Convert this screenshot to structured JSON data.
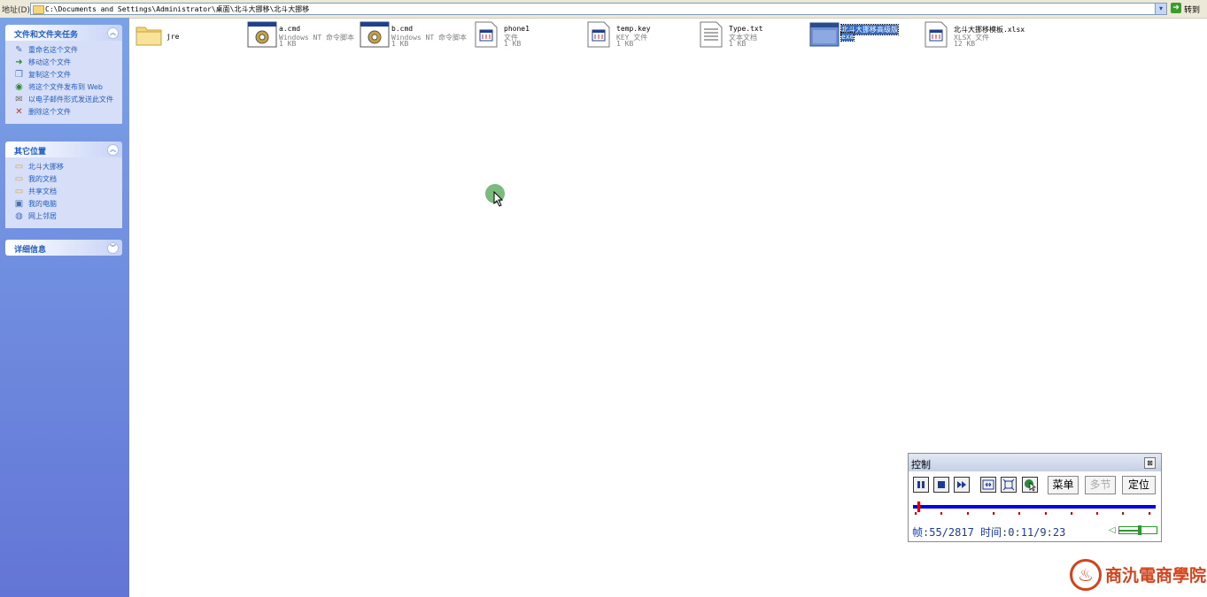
{
  "addressbar": {
    "label": "地址(D)",
    "path": "C:\\Documents and Settings\\Administrator\\桌面\\北斗大挪移\\北斗大挪移",
    "dropdown_glyph": "▾",
    "go_label": "转到"
  },
  "tasks_panel": {
    "title": "文件和文件夹任务",
    "items": [
      {
        "label": "重命名这个文件",
        "icon": "rename-icon"
      },
      {
        "label": "移动这个文件",
        "icon": "move-icon"
      },
      {
        "label": "复制这个文件",
        "icon": "copy-icon"
      },
      {
        "label": "将这个文件发布到 Web",
        "icon": "web-publish-icon"
      },
      {
        "label": "以电子邮件形式发送此文件",
        "icon": "email-icon"
      },
      {
        "label": "删除这个文件",
        "icon": "delete-icon"
      }
    ]
  },
  "other_places": {
    "title": "其它位置",
    "items": [
      {
        "label": "北斗大挪移",
        "icon": "folder-icon"
      },
      {
        "label": "我的文档",
        "icon": "documents-icon"
      },
      {
        "label": "共享文档",
        "icon": "shared-folder-icon"
      },
      {
        "label": "我的电脑",
        "icon": "computer-icon"
      },
      {
        "label": "网上邻居",
        "icon": "network-icon"
      }
    ]
  },
  "details_panel": {
    "title": "详细信息"
  },
  "files": [
    {
      "name": "jre",
      "type": "",
      "size": "",
      "icon": "folder-icon"
    },
    {
      "name": "a.cmd",
      "type": "Windows NT 命令脚本",
      "size": "1 KB",
      "icon": "cmd-script-icon"
    },
    {
      "name": "b.cmd",
      "type": "Windows NT 命令脚本",
      "size": "1 KB",
      "icon": "cmd-script-icon"
    },
    {
      "name": "phone1",
      "type": "文件",
      "size": "1 KB",
      "icon": "generic-file-icon"
    },
    {
      "name": "temp.key",
      "type": "KEY 文件",
      "size": "1 KB",
      "icon": "generic-file-icon"
    },
    {
      "name": "Type.txt",
      "type": "文本文档",
      "size": "1 KB",
      "icon": "text-file-icon"
    },
    {
      "name": "北斗大挪移高级版",
      "type": "exe",
      "size": "",
      "icon": "exe-icon",
      "selected": true
    },
    {
      "name": "北斗大挪移模板.xlsx",
      "type": "XLSX 文件",
      "size": "12 KB",
      "icon": "generic-file-icon"
    }
  ],
  "control": {
    "title": "控制",
    "close_glyph": "⊠",
    "menu_label": "菜单",
    "multi_label": "多节",
    "locate_label": "定位",
    "frame_readout": "帧:55/2817",
    "time_readout": "时间:0:11/9:23",
    "progress": 0.0195,
    "volume": 0.55,
    "accent": "#0000ee"
  },
  "watermark": {
    "text": "商氿電商學院"
  }
}
